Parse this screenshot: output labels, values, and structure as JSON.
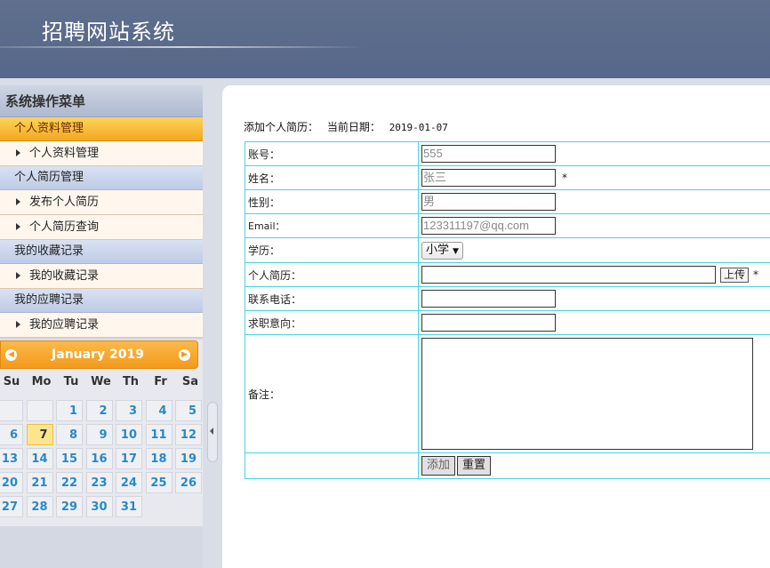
{
  "header": {
    "title": "招聘网站系统"
  },
  "sidebar": {
    "title": "系统操作菜单",
    "groups": [
      {
        "label": "个人资料管理",
        "items": [
          "个人资料管理"
        ]
      },
      {
        "label": "个人简历管理",
        "items": [
          "发布个人简历",
          "个人简历查询"
        ]
      },
      {
        "label": "我的收藏记录",
        "items": [
          "我的收藏记录"
        ]
      },
      {
        "label": "我的应聘记录",
        "items": [
          "我的应聘记录"
        ]
      }
    ],
    "active_group": 0
  },
  "calendar": {
    "month_label": "January 2019",
    "weekdays": [
      "Su",
      "Mo",
      "Tu",
      "We",
      "Th",
      "Fr",
      "Sa"
    ],
    "first_weekday": 2,
    "days_in_month": 31,
    "today": 7
  },
  "main": {
    "caption": "添加个人简历：",
    "date_label": "当前日期：",
    "date_value": "2019-01-07",
    "fields": {
      "account": {
        "label": "账号：",
        "value": "555"
      },
      "name": {
        "label": "姓名：",
        "value": "张三",
        "required": "*"
      },
      "gender": {
        "label": "性别：",
        "value": "男"
      },
      "email": {
        "label": "Email：",
        "value": "123311197@qq.com"
      },
      "education": {
        "label": "学历：",
        "value": "小学"
      },
      "resume": {
        "label": "个人简历：",
        "upload_label": "上传",
        "required": "*"
      },
      "phone": {
        "label": "联系电话：",
        "value": ""
      },
      "intention": {
        "label": "求职意向：",
        "value": ""
      },
      "remark": {
        "label": "备注：",
        "value": ""
      }
    },
    "buttons": {
      "add": "添加",
      "reset": "重置"
    }
  },
  "colors": {
    "header": "#56678a",
    "accent": "#f39b1b",
    "table_border": "#46d6e0",
    "link": "#2b88c4"
  }
}
